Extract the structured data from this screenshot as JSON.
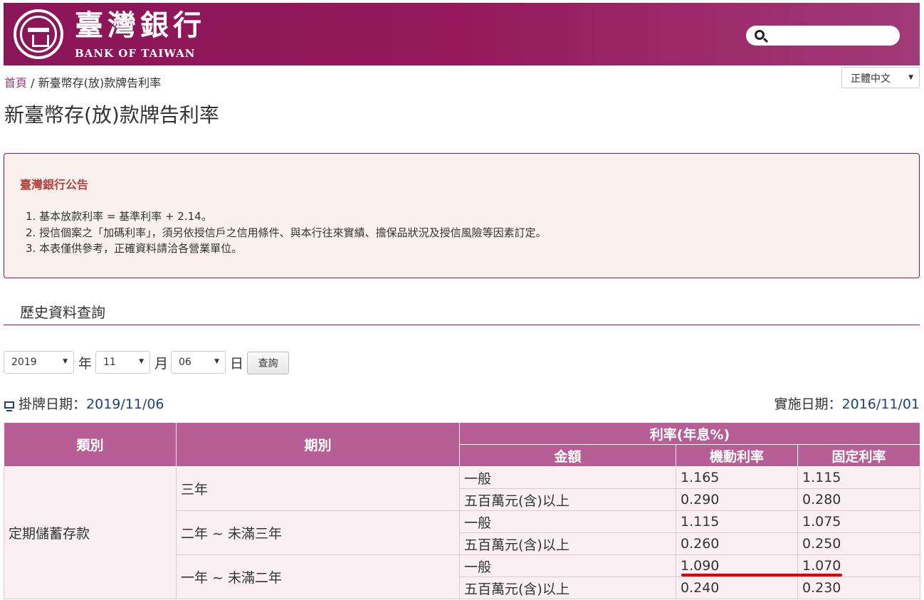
{
  "header": {
    "logo_zh": "臺灣銀行",
    "logo_en": "BANK OF TAIWAN",
    "search_placeholder": ""
  },
  "breadcrumb": {
    "home": "首頁",
    "separator": " / ",
    "current": "新臺幣存(放)款牌告利率"
  },
  "language": {
    "selected": "正體中文"
  },
  "page_title": "新臺幣存(放)款牌告利率",
  "notice": {
    "title": "臺灣銀行公告",
    "items": [
      "1. 基本放款利率 = 基準利率 + 2.14。",
      "2. 授信個案之「加碼利率」，須另依授信戶之信用條件、與本行往來實績、擔保品狀況及授信風險等因素訂定。",
      "3. 本表僅供參考，正確資料請洽各營業單位。"
    ]
  },
  "history": {
    "title": "歷史資料查詢",
    "year": "2019",
    "year_unit": "年",
    "month": "11",
    "month_unit": "月",
    "day": "06",
    "day_unit": "日",
    "query_button": "查詢"
  },
  "dates": {
    "posted_label": "掛牌日期：",
    "posted_value": "2019/11/06",
    "effective_label": "實施日期：",
    "effective_value": "2016/11/01"
  },
  "table": {
    "headers": {
      "category": "類別",
      "period": "期別",
      "rate": "利率(年息%)",
      "amount": "金額",
      "floating": "機動利率",
      "fixed": "固定利率"
    },
    "category": "定期儲蓄存款",
    "periods": [
      {
        "name": "三年",
        "rows": [
          {
            "amount": "一般",
            "floating": "1.165",
            "fixed": "1.115"
          },
          {
            "amount": "五百萬元(含)以上",
            "floating": "0.290",
            "fixed": "0.280"
          }
        ]
      },
      {
        "name": "二年 ~ 未滿三年",
        "rows": [
          {
            "amount": "一般",
            "floating": "1.115",
            "fixed": "1.075"
          },
          {
            "amount": "五百萬元(含)以上",
            "floating": "0.260",
            "fixed": "0.250"
          }
        ]
      },
      {
        "name": "一年 ~ 未滿二年",
        "rows": [
          {
            "amount": "一般",
            "floating": "1.090",
            "fixed": "1.070"
          },
          {
            "amount": "五百萬元(含)以上",
            "floating": "0.240",
            "fixed": "0.230"
          }
        ]
      }
    ]
  }
}
